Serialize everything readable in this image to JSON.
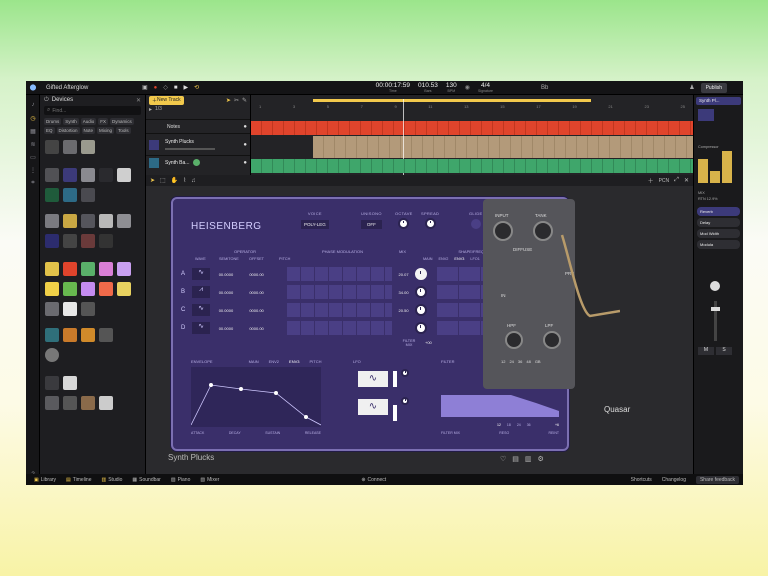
{
  "project": {
    "name": "Gifted Afterglow"
  },
  "transport": {
    "time": "00:00:17:59",
    "time_label": "Time",
    "bars": "010.53",
    "bars_label": "Bars",
    "bpm": "130",
    "bpm_label": "BPM",
    "sig": "4/4",
    "sig_label": "Signature",
    "pitch": "Bb",
    "publish": "Publish"
  },
  "browser": {
    "title": "Devices",
    "search_placeholder": "Find...",
    "filters": [
      "Drums",
      "Synth",
      "Audio",
      "FX",
      "Dynamics",
      "EQ",
      "Distortion",
      "Note",
      "Mixing",
      "Tools"
    ]
  },
  "tracks": {
    "new_track": "New Track",
    "counter": "1/3",
    "rows": [
      {
        "name": "Notes"
      },
      {
        "name": "Synth Plucks"
      },
      {
        "name": "Synth Ba..."
      }
    ]
  },
  "timeline": {
    "ruler": [
      "1",
      "3",
      "5",
      "7",
      "9",
      "11",
      "13",
      "15",
      "17",
      "19",
      "21",
      "23",
      "25"
    ]
  },
  "devicebar": {
    "zoom": "PCN"
  },
  "heisenberg": {
    "name": "HEISENBERG",
    "voice_label": "VOICE",
    "voice_value": "POLY-LEG",
    "unisono_label": "UNISONO",
    "unisono_value": "OFF",
    "glide_label": "GLIDE",
    "octave_label": "OCTAVE",
    "spread_label": "SPREAD",
    "quality_label": "QUALITY",
    "volume_label": "VOLUME",
    "sections": [
      "OPERATOR",
      "PHASE MODULATION",
      "MIX",
      "SHAPE/FREQ MODULATION"
    ],
    "op_headers": [
      "WAVE",
      "SEMITONE",
      "OFFSET",
      "PITCH"
    ],
    "mix_tabs": [
      "MAIN",
      "ENV2",
      "ENV3",
      "LFO1",
      "LFO 2",
      "VEL"
    ],
    "operators": [
      {
        "letter": "A",
        "semitone": "00.0000",
        "offset": "0000.00",
        "mix": "20.07"
      },
      {
        "letter": "B",
        "semitone": "00.0000",
        "offset": "0000.00",
        "mix": "34.00"
      },
      {
        "letter": "C",
        "semitone": "00.0000",
        "offset": "0000.00",
        "mix": "20.50"
      },
      {
        "letter": "D",
        "semitone": "00.0000",
        "offset": "0000.00",
        "mix": ""
      }
    ],
    "filter_mix_label": "FILTER MIX",
    "filter_mix_value": "+00",
    "env_title": "ENVELOPE",
    "env_tabs": [
      "MAIN",
      "ENV2",
      "ENV3",
      "PITCH"
    ],
    "env_labels": [
      "ATTACK",
      "DECAY",
      "SUSTAIN",
      "RELEASE"
    ],
    "lfo_title": "LFO",
    "filter_title": "FILTER",
    "filter_labels": [
      "FILTER MIX",
      "RESO",
      "REINT"
    ],
    "filter_values": [
      "12",
      "18",
      "24",
      "36",
      "+6"
    ]
  },
  "quasar": {
    "name": "Quasar",
    "labels": [
      "INPUT",
      "TANK",
      "DIFFUSE",
      "HPF",
      "LPF",
      "PRE"
    ],
    "scale": [
      "12",
      "24",
      "36",
      "48",
      "GB"
    ],
    "input": "IN"
  },
  "instrument_label": "Synth Plucks",
  "right_panel": {
    "track": "Synth Pl...",
    "devices": [
      "Compressor",
      "Reverb",
      "Delay",
      "Mod Width",
      "Modula"
    ],
    "values": [
      "MIX",
      "RTN 12.9%"
    ],
    "ms": [
      "M",
      "S"
    ]
  },
  "bottom": {
    "left": [
      "Library",
      "Timeline",
      "Studio",
      "Soundbar",
      "Piano",
      "Mixer"
    ],
    "center": "Connect",
    "right": [
      "Shortcuts",
      "Changelog",
      "Share feedback"
    ]
  },
  "colors": {
    "accent": "#f2c94c",
    "heisenberg": "#3a2f6a",
    "clip_red": "#e0442c",
    "clip_tan": "#b39a7a",
    "clip_green": "#3fa66b"
  }
}
